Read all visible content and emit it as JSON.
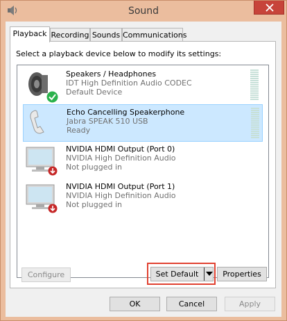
{
  "window": {
    "title": "Sound"
  },
  "tabs": [
    {
      "label": "Playback",
      "active": true
    },
    {
      "label": "Recording",
      "active": false
    },
    {
      "label": "Sounds",
      "active": false
    },
    {
      "label": "Communications",
      "active": false
    }
  ],
  "instruction": "Select a playback device below to modify its settings:",
  "devices": [
    {
      "name": "Speakers / Headphones",
      "line1": "IDT High Definition Audio CODEC",
      "line2": "Default Device",
      "icon": "speaker-icon",
      "badge": "default-check-badge",
      "selected": false,
      "meter": true
    },
    {
      "name": "Echo Cancelling Speakerphone",
      "line1": "Jabra SPEAK 510 USB",
      "line2": "Ready",
      "icon": "speakerphone-icon",
      "selected": true,
      "meter": true
    },
    {
      "name": "NVIDIA HDMI Output (Port 0)",
      "line1": "NVIDIA High Definition Audio",
      "line2": "Not plugged in",
      "icon": "monitor-icon",
      "badge": "unplugged-badge",
      "selected": false,
      "meter": false
    },
    {
      "name": "NVIDIA HDMI Output (Port 1)",
      "line1": "NVIDIA High Definition Audio",
      "line2": "Not plugged in",
      "icon": "monitor-icon",
      "badge": "unplugged-badge",
      "selected": false,
      "meter": false
    }
  ],
  "buttons": {
    "configure": "Configure",
    "set_default": "Set Default",
    "properties": "Properties",
    "ok": "OK",
    "cancel": "Cancel",
    "apply": "Apply"
  },
  "colors": {
    "titlebar": "#ebbd9e",
    "close": "#c7443a",
    "selection": "#cce8ff",
    "highlight_box": "#e04030",
    "default_check": "#2bb24c",
    "unplugged": "#c62828"
  }
}
